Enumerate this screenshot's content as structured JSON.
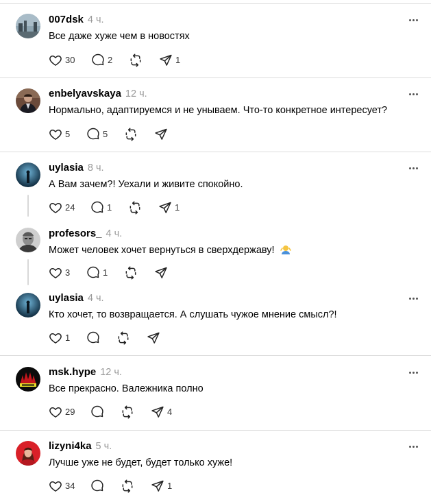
{
  "comments": [
    {
      "username": "007dsk",
      "time": "4 ч.",
      "text": "Все даже хуже чем в новостях",
      "likes": "30",
      "replies": "2",
      "reposts": "",
      "shares": "1"
    },
    {
      "username": "enbelyavskaya",
      "time": "12 ч.",
      "text": "Нормально, адаптируемся и не унываем. Что-то конкретное интересует?",
      "likes": "5",
      "replies": "5",
      "reposts": "",
      "shares": ""
    },
    {
      "username": "uylasia",
      "time": "8 ч.",
      "text": "А Вам зачем?! Уехали и живите спокойно.",
      "likes": "24",
      "replies": "1",
      "reposts": "",
      "shares": "1"
    },
    {
      "username": "profesors_",
      "time": "4 ч.",
      "text": "Может человек хочет вернуться в сверхдержаву!",
      "likes": "3",
      "replies": "1",
      "reposts": "",
      "shares": ""
    },
    {
      "username": "uylasia",
      "time": "4 ч.",
      "text": "Кто хочет, то возвращается. А слушать чужое мнение смысл?!",
      "likes": "1",
      "replies": "",
      "reposts": "",
      "shares": ""
    },
    {
      "username": "msk.hype",
      "time": "12 ч.",
      "text": "Все прекрасно. Валежника полно",
      "likes": "29",
      "replies": "",
      "reposts": "",
      "shares": "4"
    },
    {
      "username": "lizyni4ka",
      "time": "5 ч.",
      "text": "Лучше уже не будет, будет только хуже!",
      "likes": "34",
      "replies": "",
      "reposts": "",
      "shares": "1"
    }
  ],
  "icons": {
    "like": "heart-icon",
    "reply": "speech-bubble-icon",
    "repost": "repost-icon",
    "share": "send-icon",
    "more": "more-dots-icon",
    "emoji": "shrug-emoji"
  },
  "colors": {
    "text": "#000000",
    "muted": "#999999",
    "separator": "#dcdcdc",
    "icon": "#333333"
  }
}
